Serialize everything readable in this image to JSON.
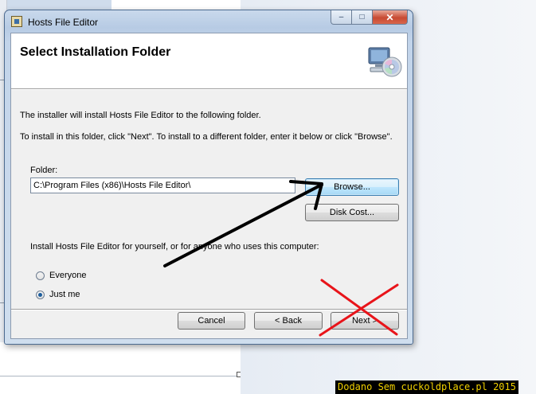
{
  "window": {
    "title": "Hosts File Editor",
    "caption_buttons": {
      "minimize": "–",
      "maximize": "□",
      "close": "✕"
    }
  },
  "banner": {
    "title": "Select Installation Folder",
    "icon": "computer-cd-icon"
  },
  "body": {
    "intro": "The installer will install Hosts File Editor to the following folder.",
    "instruction": "To install in this folder, click \"Next\". To install to a different folder, enter it below or click \"Browse\".",
    "folder_label": "Folder:",
    "folder_value": "C:\\Program Files (x86)\\Hosts File Editor\\",
    "browse_label": "Browse...",
    "disk_cost_label": "Disk Cost...",
    "install_for_label": "Install Hosts File Editor for yourself, or for anyone who uses this computer:",
    "options": [
      {
        "label": "Everyone",
        "selected": false
      },
      {
        "label": "Just me",
        "selected": true
      }
    ]
  },
  "footer": {
    "cancel_label": "Cancel",
    "back_label": "< Back",
    "next_label": "Next >"
  },
  "annotations": {
    "arrow_color": "#000000",
    "cross_color": "#e8141a"
  },
  "watermark": "Dodano Sem cuckoldplace.pl 2015"
}
